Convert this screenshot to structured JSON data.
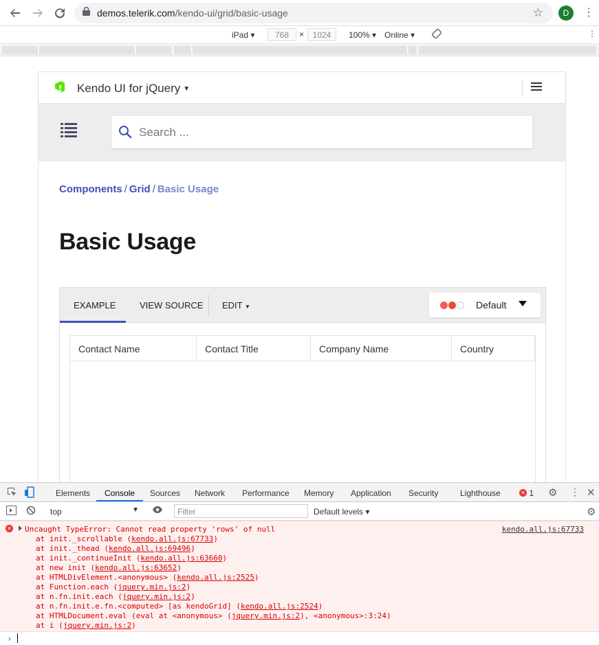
{
  "browser": {
    "url_host": "demos.telerik.com",
    "url_path": "/kendo-ui/grid/basic-usage",
    "profile_initial": "D"
  },
  "device_toolbar": {
    "device": "iPad",
    "width": "768",
    "times": "×",
    "height": "1024",
    "zoom": "100%",
    "network": "Online"
  },
  "site": {
    "brand": "Kendo UI for jQuery",
    "search_placeholder": "Search ...",
    "breadcrumb": [
      "Components",
      "/",
      "Grid",
      "/",
      "Basic Usage"
    ],
    "title": "Basic Usage",
    "demo_tabs": [
      "EXAMPLE",
      "VIEW SOURCE",
      "EDIT"
    ],
    "theme": "Default",
    "swatch_colors": [
      "#f35c5c",
      "#e74c3c",
      "#ffffff"
    ],
    "grid_columns": [
      "Contact Name",
      "Contact Title",
      "Company Name",
      "Country"
    ]
  },
  "devtools": {
    "tabs": [
      "Elements",
      "Console",
      "Sources",
      "Network",
      "Performance",
      "Memory",
      "Application",
      "Security",
      "Lighthouse"
    ],
    "active_tab": "Console",
    "error_count": "1",
    "context": "top",
    "filter_placeholder": "Filter",
    "levels": "Default levels",
    "error": {
      "message": "Uncaught TypeError: Cannot read property 'rows' of null",
      "source": "kendo.all.js:67733",
      "stack": [
        {
          "pre": "at init._scrollable (",
          "link": "kendo.all.js:67733",
          "post": ")"
        },
        {
          "pre": "at init._thead (",
          "link": "kendo.all.js:69496",
          "post": ")"
        },
        {
          "pre": "at init._continueInit (",
          "link": "kendo.all.js:63660",
          "post": ")"
        },
        {
          "pre": "at new init (",
          "link": "kendo.all.js:63652",
          "post": ")"
        },
        {
          "pre": "at HTMLDivElement.<anonymous> (",
          "link": "kendo.all.js:2525",
          "post": ")"
        },
        {
          "pre": "at Function.each (",
          "link": "jquery.min.js:2",
          "post": ")"
        },
        {
          "pre": "at n.fn.init.each (",
          "link": "jquery.min.js:2",
          "post": ")"
        },
        {
          "pre": "at n.fn.init.e.fn.<computed> [as kendoGrid] (",
          "link": "kendo.all.js:2524",
          "post": ")"
        },
        {
          "pre": "at HTMLDocument.eval (eval at <anonymous> (",
          "link": "jquery.min.js:2",
          "post": "), <anonymous>:3:24)"
        },
        {
          "pre": "at i (",
          "link": "jquery.min.js:2",
          "post": ")"
        }
      ]
    }
  }
}
